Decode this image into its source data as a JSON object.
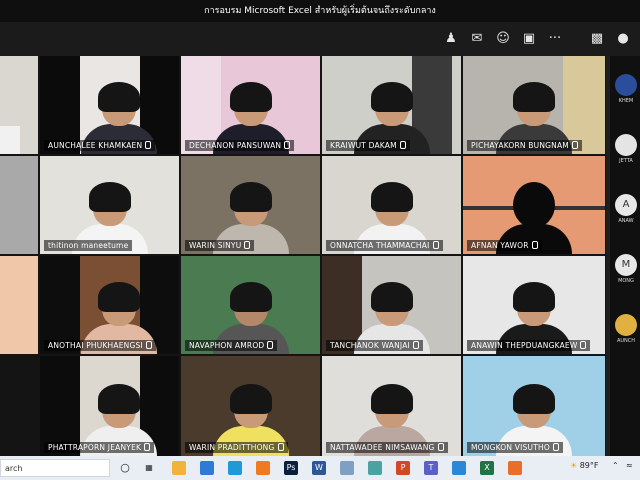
{
  "window": {
    "title": "การอบรม Microsoft Excel สำหรับผู้เริ่มต้นจนถึงระดับกลาง"
  },
  "toolbar": {
    "icons": [
      "people-icon",
      "chat-icon",
      "reactions-icon",
      "share-icon",
      "more-icon",
      "camera-icon",
      "mic-icon"
    ],
    "more_label": "···"
  },
  "participants": [
    {
      "name": "",
      "row": 0,
      "col": 0
    },
    {
      "name": "AUNCHALEE KHAMKAEN",
      "row": 0,
      "col": 1
    },
    {
      "name": "DECHANON PANSUWAN",
      "row": 0,
      "col": 2
    },
    {
      "name": "KRAIWUT DAKAM",
      "row": 0,
      "col": 3
    },
    {
      "name": "PICHAYAKORN BUNGNAM",
      "row": 0,
      "col": 4
    },
    {
      "name": "",
      "row": 1,
      "col": 0
    },
    {
      "name": "thitinon maneetume",
      "row": 1,
      "col": 1
    },
    {
      "name": "WARIN SINYU",
      "row": 1,
      "col": 2
    },
    {
      "name": "ONNATCHA THAMMACHAI",
      "row": 1,
      "col": 3
    },
    {
      "name": "AFNAN YAWOR",
      "row": 1,
      "col": 4
    },
    {
      "name": "",
      "row": 2,
      "col": 0
    },
    {
      "name": "ANOTHAI PHUKHAENGSI",
      "row": 2,
      "col": 1
    },
    {
      "name": "NAVAPHON AMROD",
      "row": 2,
      "col": 2
    },
    {
      "name": "TANCHANOK WANJAI",
      "row": 2,
      "col": 3
    },
    {
      "name": "ANAWIN THEPDUANGKAEW",
      "row": 2,
      "col": 4
    },
    {
      "name": "PHATTRAPORN JEANYEK",
      "row": 3,
      "col": 1
    },
    {
      "name": "WARIN PRADITTHONG",
      "row": 3,
      "col": 2
    },
    {
      "name": "NATTAWADEE NIMSAWANG",
      "row": 3,
      "col": 3
    },
    {
      "name": "MONGKON VISUTHO",
      "row": 3,
      "col": 4
    }
  ],
  "sidebar": {
    "items": [
      {
        "initial": "",
        "name": "KHEM",
        "color": "#2a4d9c"
      },
      {
        "initial": "",
        "name": "JETTA",
        "color": "#e4e4e4"
      },
      {
        "initial": "A",
        "name": "ANAW",
        "color": "#e8e8e8"
      },
      {
        "initial": "M",
        "name": "MONG",
        "color": "#e8e8e8"
      },
      {
        "initial": "",
        "name": "AUNCH",
        "color": "#e0b040"
      }
    ]
  },
  "taskbar": {
    "search_text": "arch",
    "weather": "89°F",
    "apps": [
      "start-icon",
      "taskview-icon",
      "explorer-icon",
      "mail-icon",
      "edge-icon",
      "xampp-icon",
      "photoshop-icon",
      "word-icon",
      "notepad-icon",
      "files-icon",
      "powerpoint-icon",
      "teams-icon",
      "photos-icon",
      "excel-icon",
      "media-icon"
    ]
  }
}
